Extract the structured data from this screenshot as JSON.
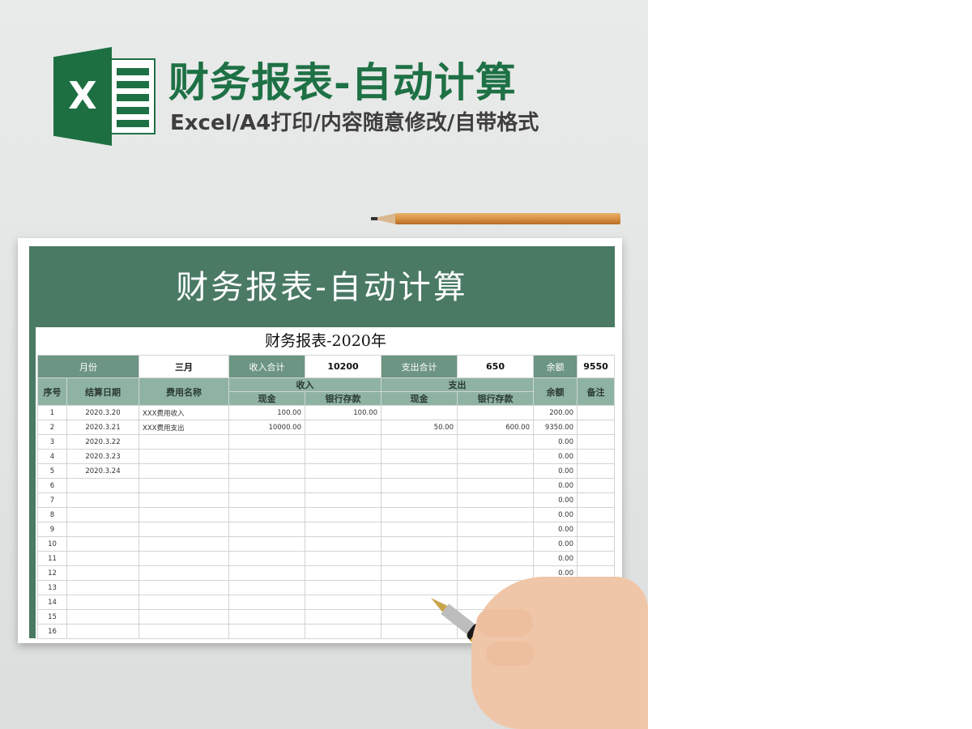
{
  "colors": {
    "brand_green": "#1e7145",
    "banner_green": "#4a7a64",
    "header_green": "#8fb3a3",
    "label_green": "#6d9583"
  },
  "hero": {
    "logo_letter": "X",
    "title": "财务报表-自动计算",
    "subtitle": "Excel/A4打印/内容随意修改/自带格式"
  },
  "sheet": {
    "banner_title": "财务报表-自动计算",
    "report_title": "财务报表-2020年",
    "summary": {
      "month_label": "月份",
      "month_value": "三月",
      "income_label": "收入合计",
      "income_value": "10200",
      "expense_label": "支出合计",
      "expense_value": "650",
      "balance_label": "余额",
      "balance_value": "9550"
    },
    "headers": {
      "seq": "序号",
      "date": "结算日期",
      "item": "费用名称",
      "income": "收入",
      "expense": "支出",
      "cash": "现金",
      "bank": "银行存款",
      "balance": "余额",
      "note": "备注"
    },
    "rows": [
      {
        "seq": "1",
        "date": "2020.3.20",
        "item": "XXX费用收入",
        "in_cash": "100.00",
        "in_bank": "100.00",
        "out_cash": "",
        "out_bank": "",
        "balance": "200.00",
        "note": ""
      },
      {
        "seq": "2",
        "date": "2020.3.21",
        "item": "XXX费用支出",
        "in_cash": "10000.00",
        "in_bank": "",
        "out_cash": "50.00",
        "out_bank": "600.00",
        "balance": "9350.00",
        "note": ""
      },
      {
        "seq": "3",
        "date": "2020.3.22",
        "item": "",
        "in_cash": "",
        "in_bank": "",
        "out_cash": "",
        "out_bank": "",
        "balance": "0.00",
        "note": ""
      },
      {
        "seq": "4",
        "date": "2020.3.23",
        "item": "",
        "in_cash": "",
        "in_bank": "",
        "out_cash": "",
        "out_bank": "",
        "balance": "0.00",
        "note": ""
      },
      {
        "seq": "5",
        "date": "2020.3.24",
        "item": "",
        "in_cash": "",
        "in_bank": "",
        "out_cash": "",
        "out_bank": "",
        "balance": "0.00",
        "note": ""
      },
      {
        "seq": "6",
        "date": "",
        "item": "",
        "in_cash": "",
        "in_bank": "",
        "out_cash": "",
        "out_bank": "",
        "balance": "0.00",
        "note": ""
      },
      {
        "seq": "7",
        "date": "",
        "item": "",
        "in_cash": "",
        "in_bank": "",
        "out_cash": "",
        "out_bank": "",
        "balance": "0.00",
        "note": ""
      },
      {
        "seq": "8",
        "date": "",
        "item": "",
        "in_cash": "",
        "in_bank": "",
        "out_cash": "",
        "out_bank": "",
        "balance": "0.00",
        "note": ""
      },
      {
        "seq": "9",
        "date": "",
        "item": "",
        "in_cash": "",
        "in_bank": "",
        "out_cash": "",
        "out_bank": "",
        "balance": "0.00",
        "note": ""
      },
      {
        "seq": "10",
        "date": "",
        "item": "",
        "in_cash": "",
        "in_bank": "",
        "out_cash": "",
        "out_bank": "",
        "balance": "0.00",
        "note": ""
      },
      {
        "seq": "11",
        "date": "",
        "item": "",
        "in_cash": "",
        "in_bank": "",
        "out_cash": "",
        "out_bank": "",
        "balance": "0.00",
        "note": ""
      },
      {
        "seq": "12",
        "date": "",
        "item": "",
        "in_cash": "",
        "in_bank": "",
        "out_cash": "",
        "out_bank": "",
        "balance": "0.00",
        "note": ""
      },
      {
        "seq": "13",
        "date": "",
        "item": "",
        "in_cash": "",
        "in_bank": "",
        "out_cash": "",
        "out_bank": "",
        "balance": "0.00",
        "note": ""
      },
      {
        "seq": "14",
        "date": "",
        "item": "",
        "in_cash": "",
        "in_bank": "",
        "out_cash": "",
        "out_bank": "",
        "balance": "",
        "note": ""
      },
      {
        "seq": "15",
        "date": "",
        "item": "",
        "in_cash": "",
        "in_bank": "",
        "out_cash": "",
        "out_bank": "",
        "balance": "",
        "note": ""
      },
      {
        "seq": "16",
        "date": "",
        "item": "",
        "in_cash": "",
        "in_bank": "",
        "out_cash": "",
        "out_bank": "",
        "balance": "",
        "note": ""
      }
    ]
  }
}
